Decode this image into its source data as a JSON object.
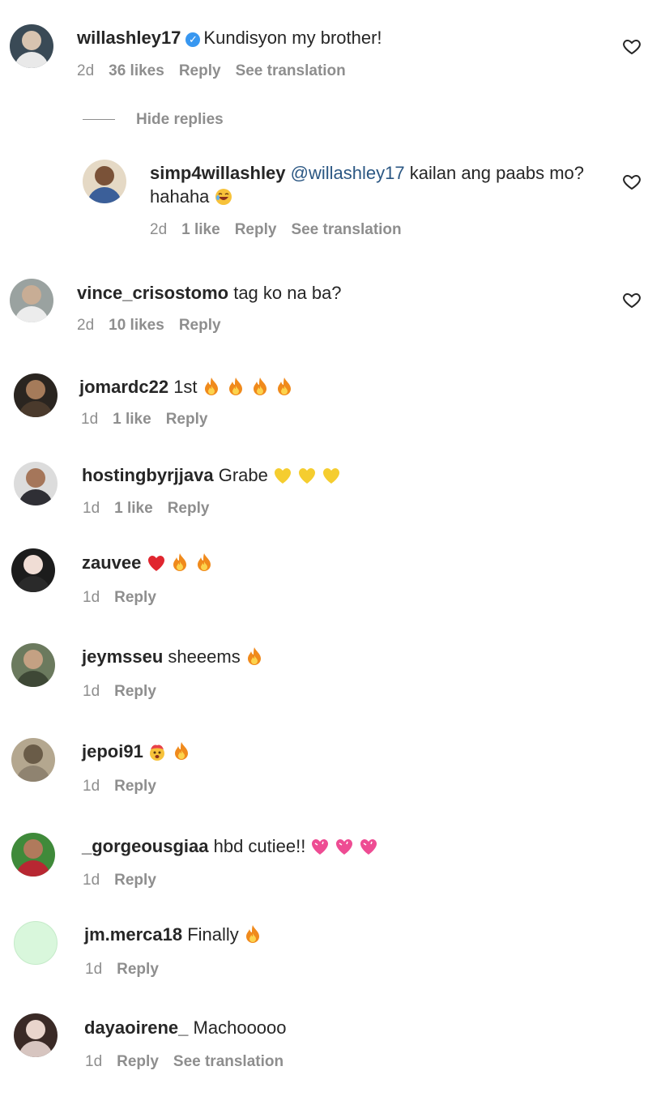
{
  "hide_replies_label": "Hide replies",
  "comments": [
    {
      "username": "willashley17",
      "verified": true,
      "text": "Kundisyon my brother!",
      "time": "2d",
      "likes": "36 likes",
      "reply_label": "Reply",
      "translate_label": "See translation"
    },
    {
      "username": "simp4willashley",
      "mention": "@willashley17",
      "text": " kailan ang paabs mo?",
      "text_line2": "hahaha",
      "time": "2d",
      "likes": "1 like",
      "reply_label": "Reply",
      "translate_label": "See translation"
    },
    {
      "username": "vince_crisostomo",
      "text": "tag ko na ba?",
      "time": "2d",
      "likes": "10 likes",
      "reply_label": "Reply"
    },
    {
      "username": "jomardc22",
      "text": "1st",
      "time": "1d",
      "likes": "1 like",
      "reply_label": "Reply"
    },
    {
      "username": "hostingbyrjjava",
      "text": "Grabe",
      "time": "1d",
      "likes": "1 like",
      "reply_label": "Reply"
    },
    {
      "username": "zauvee",
      "text": "",
      "time": "1d",
      "reply_label": "Reply"
    },
    {
      "username": "jeymsseu",
      "text": "sheeems",
      "time": "1d",
      "reply_label": "Reply"
    },
    {
      "username": "jepoi91",
      "text": "",
      "time": "1d",
      "reply_label": "Reply"
    },
    {
      "username": "_gorgeousgiaa",
      "text": "hbd cutiee!!",
      "time": "1d",
      "reply_label": "Reply"
    },
    {
      "username": "jm.merca18",
      "text": "Finally",
      "time": "1d",
      "reply_label": "Reply"
    },
    {
      "username": "dayaoirene_",
      "text": "Machooooo",
      "time": "1d",
      "reply_label": "Reply",
      "translate_label": "See translation"
    }
  ],
  "emojis": {
    "jomardc22": [
      "fire-icon",
      "fire-icon",
      "fire-icon",
      "fire-icon"
    ],
    "hostingbyrjjava": [
      "yellow-heart-icon",
      "yellow-heart-icon",
      "yellow-heart-icon"
    ],
    "zauvee": [
      "red-heart-icon",
      "fire-icon",
      "fire-icon"
    ],
    "jeymsseu": [
      "fire-icon"
    ],
    "jepoi91": [
      "exploding-head-icon",
      "fire-icon"
    ],
    "_gorgeousgiaa": [
      "pink-heart-icon",
      "pink-heart-icon",
      "pink-heart-icon"
    ],
    "jm.merca18": [
      "fire-icon"
    ],
    "simp4willashley": [
      "laughing-icon"
    ]
  },
  "colors": {
    "text": "#262626",
    "muted": "#8e8e8e",
    "mention": "#2b5783",
    "verified": "#3897f0"
  }
}
